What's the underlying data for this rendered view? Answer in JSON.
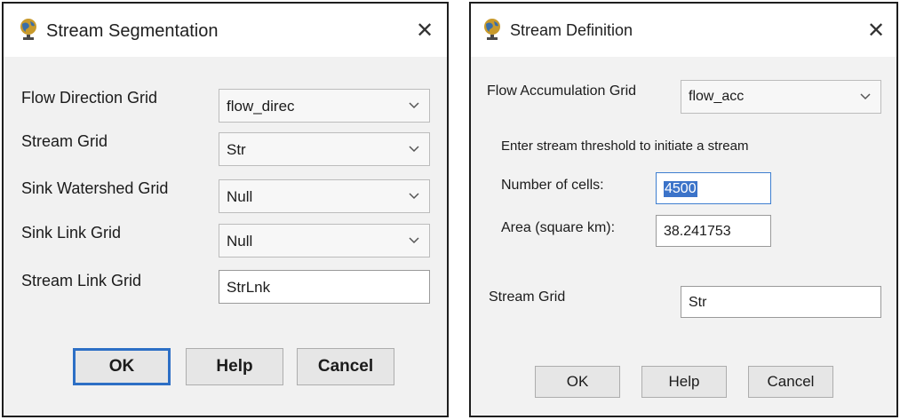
{
  "segmentation": {
    "title": "Stream Segmentation",
    "fields": [
      {
        "label": "Flow Direction Grid",
        "value": "flow_direc"
      },
      {
        "label": "Stream Grid",
        "value": "Str"
      },
      {
        "label": "Sink Watershed Grid",
        "value": "Null"
      },
      {
        "label": "Sink Link Grid",
        "value": "Null"
      }
    ],
    "stream_link": {
      "label": "Stream Link Grid",
      "value": "StrLnk"
    },
    "buttons": {
      "ok": "OK",
      "help": "Help",
      "cancel": "Cancel"
    }
  },
  "definition": {
    "title": "Stream Definition",
    "flow_acc": {
      "label": "Flow Accumulation Grid",
      "value": "flow_acc"
    },
    "threshold_note": "Enter stream threshold to initiate a stream",
    "cells": {
      "label": "Number of cells:",
      "value": "4500"
    },
    "area": {
      "label": "Area (square km):",
      "value": "38.241753"
    },
    "stream_grid": {
      "label": "Stream Grid",
      "value": "Str"
    },
    "buttons": {
      "ok": "OK",
      "help": "Help",
      "cancel": "Cancel"
    }
  },
  "icons": {
    "title_icon": "globe-icon",
    "close": "close-icon",
    "dropdown": "chevron-down-icon"
  }
}
